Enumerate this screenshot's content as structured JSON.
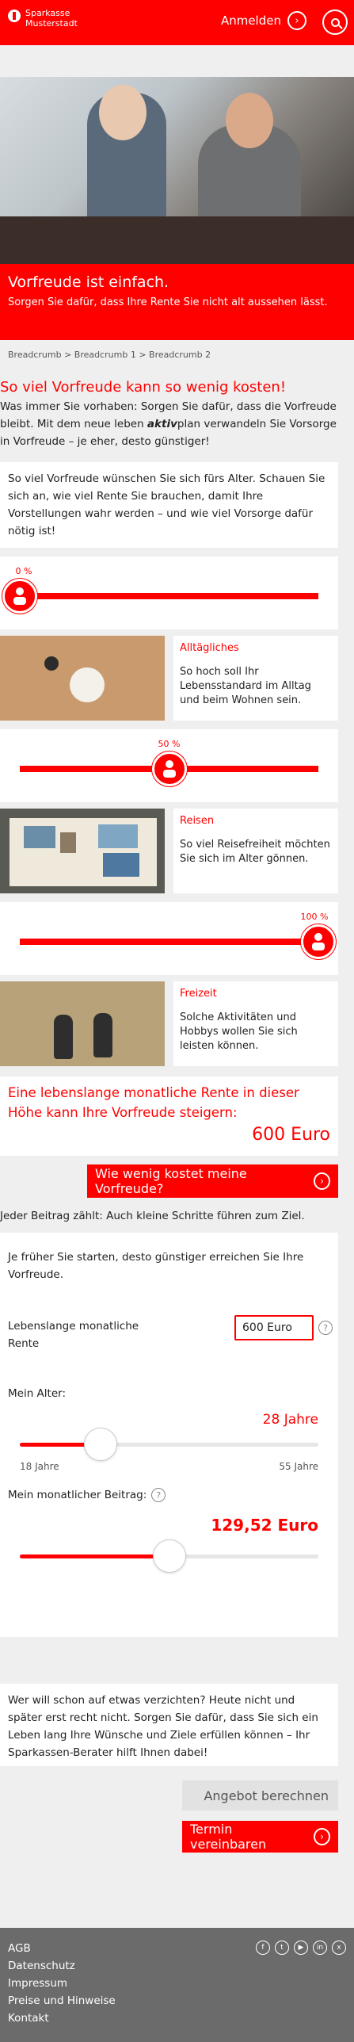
{
  "header": {
    "brand_line1": "Sparkasse",
    "brand_line2": "Musterstadt",
    "login_label": "Anmelden",
    "login_icon": "chevron-right-icon",
    "search_icon": "search-icon",
    "brand_color": "#ff0000"
  },
  "hero": {
    "title": "Vorfreude ist einfach.",
    "subtitle": "Sorgen Sie dafür, dass Ihre Rente Sie nicht alt aussehen lässt."
  },
  "breadcrumb": "Breadcrumb > Breadcrumb 1 > Breadcrumb 2",
  "intro": {
    "title": "So viel Vorfreude kann so wenig kosten!",
    "text_part1": "Was immer Sie vorhaben: Sorgen Sie dafür, dass die Vorfreude bleibt. Mit dem neue leben ",
    "text_em": "aktiv",
    "text_part2": "plan verwandeln Sie Vorsorge in Vorfreude – je eher, desto günstiger!"
  },
  "wish_text": "So viel Vorfreude wünschen Sie sich fürs Alter. Schauen Sie sich an, wie viel Rente Sie brauchen, damit Ihre Vorstellungen wahr werden – und wie viel Vorsorge dafür nötig ist!",
  "sliders": [
    {
      "percent_label": "0 %",
      "level": 0
    },
    {
      "percent_label": "50 %",
      "level": 0.5
    },
    {
      "percent_label": "100 %",
      "level": 1
    }
  ],
  "categories": [
    {
      "title": "Alltägliches",
      "desc": "So hoch soll Ihr Lebensstandard im Alltag und beim Wohnen sein."
    },
    {
      "title": "Reisen",
      "desc": "So viel Reisefreiheit möchten Sie sich im Alter gönnen."
    },
    {
      "title": "Freizeit",
      "desc": "Solche Aktivitäten und Hobbys wollen Sie sich leisten können."
    }
  ],
  "rent": {
    "title": "Eine lebenslange monatliche Rente in dieser Höhe kann Ihre Vorfreude steigern:",
    "value": "600 Euro"
  },
  "cta_cost": "Wie wenig kostet meine Vorfreude?",
  "note": "Jeder Beitrag zählt: Auch kleine Schritte führen zum Ziel.",
  "calculator": {
    "intro": "Je früher Sie starten, desto günstiger erreichen Sie Ihre Vorfreude.",
    "rent_label": "Lebenslange monatliche Rente",
    "rent_input_value": "600 Euro",
    "age_label": "Mein Alter:",
    "age_value": "28 Jahre",
    "age_level": 0.27,
    "age_min": "18 Jahre",
    "age_max": "55 Jahre",
    "contrib_label": "Mein monatlicher Beitrag:",
    "contrib_value": "129,52 Euro",
    "contrib_level": 0.5,
    "help_icon": "help-icon"
  },
  "outro": "Wer will schon auf etwas verzichten? Heute nicht und später erst recht nicht. Sorgen Sie dafür, dass Sie sich ein Leben lang Ihre Wünsche und Ziele erfüllen können – Ihr Sparkassen-Berater hilft Ihnen dabei!",
  "buttons": {
    "offer": "Angebot berechnen",
    "appointment": "Termin vereinbaren"
  },
  "footer": {
    "links": [
      "AGB",
      "Datenschutz",
      "Impressum",
      "Preise und Hinweise",
      "Kontakt"
    ],
    "social_icons": [
      "facebook-icon",
      "twitter-icon",
      "youtube-icon",
      "linkedin-icon",
      "xing-icon"
    ]
  }
}
